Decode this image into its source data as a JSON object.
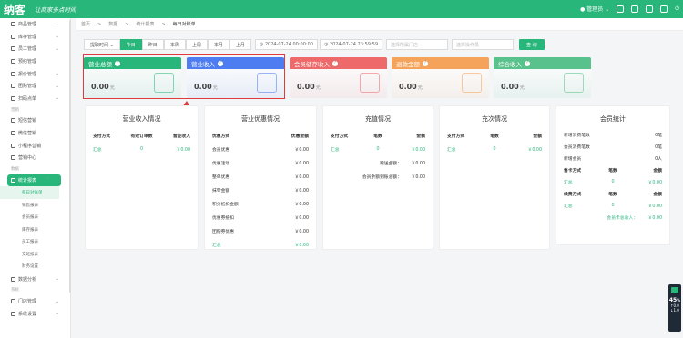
{
  "topbar": {
    "logo": "纳客",
    "slogan": "让商家多点时间",
    "user": "管理员",
    "icons": [
      "user-icon",
      "headset-icon",
      "mail-icon",
      "settings-icon",
      "power-icon"
    ]
  },
  "sidebar": {
    "items": [
      {
        "type": "item",
        "label": "商品管理",
        "chev": "⌄"
      },
      {
        "type": "item",
        "label": "库存管理",
        "chev": "⌄"
      },
      {
        "type": "item",
        "label": "员工管理",
        "chev": "⌄"
      },
      {
        "type": "item",
        "label": "预约管理",
        "chev": ""
      },
      {
        "type": "item",
        "label": "报价管理",
        "chev": "⌄"
      },
      {
        "type": "item",
        "label": "团购管理",
        "chev": "⌄"
      },
      {
        "type": "item",
        "label": "扫码点单",
        "chev": "⌄"
      },
      {
        "type": "sec",
        "label": "营销"
      },
      {
        "type": "item",
        "label": "短信营销",
        "chev": ""
      },
      {
        "type": "item",
        "label": "微信营销",
        "chev": ""
      },
      {
        "type": "item",
        "label": "小程序营销",
        "chev": ""
      },
      {
        "type": "item",
        "label": "营销中心",
        "chev": ""
      },
      {
        "type": "sec",
        "label": "数据"
      },
      {
        "type": "item",
        "label": "统计报表",
        "chev": "⌃",
        "active": true
      },
      {
        "type": "sub",
        "label": "每日对账单",
        "active": true
      },
      {
        "type": "sub",
        "label": "销售报表"
      },
      {
        "type": "sub",
        "label": "会员报表"
      },
      {
        "type": "sub",
        "label": "库存报表"
      },
      {
        "type": "sub",
        "label": "员工报表"
      },
      {
        "type": "sub",
        "label": "交班报表"
      },
      {
        "type": "sub",
        "label": "财务设置"
      },
      {
        "type": "item",
        "label": "数据分析",
        "chev": "⌄"
      },
      {
        "type": "sec",
        "label": "系统"
      },
      {
        "type": "item",
        "label": "门店管理",
        "chev": "⌄"
      },
      {
        "type": "item",
        "label": "系统设置",
        "chev": "⌄"
      }
    ]
  },
  "breadcrumb": [
    "首页",
    "数据",
    "统计报表",
    "每日对账单"
  ],
  "filters": {
    "time_type": "提取时间 ⌄",
    "buttons": [
      "今日",
      "昨日",
      "本周",
      "上周",
      "本月",
      "上月"
    ],
    "active": "今日",
    "start": "2024-07-24 00:00:00",
    "end": "2024-07-24 23:59:59",
    "store_ph": "选择所属门店",
    "operator_ph": "选择操作员",
    "query": "查 询"
  },
  "cards": [
    {
      "title": "营业总额",
      "value": "0.00",
      "unit": "元",
      "color": "#29b67b"
    },
    {
      "title": "营业收入",
      "value": "0.00",
      "unit": "元",
      "color": "#4d7df0"
    },
    {
      "title": "会员储存收入",
      "value": "0.00",
      "unit": "元",
      "color": "#ee6a6a"
    },
    {
      "title": "退款金额",
      "value": "0.00",
      "unit": "元",
      "color": "#f5a25a"
    },
    {
      "title": "综合收入",
      "value": "0.00",
      "unit": "元",
      "color": "#59c18c"
    }
  ],
  "panels": {
    "revenue": {
      "title": "营业收入情况",
      "headers": [
        "支付方式",
        "有效订单数",
        "营业收入"
      ],
      "rows": [
        [
          "汇总",
          "0",
          "￥0.00"
        ]
      ]
    },
    "discount": {
      "title": "营业优惠情况",
      "headers": [
        "优惠方式",
        "优惠金额"
      ],
      "rows": [
        [
          "会员优惠",
          "￥0.00"
        ],
        [
          "优惠活动",
          "￥0.00"
        ],
        [
          "整单优惠",
          "￥0.00"
        ],
        [
          "抹零金额",
          "￥0.00"
        ],
        [
          "积分抵扣金额",
          "￥0.00"
        ],
        [
          "优惠券抵扣",
          "￥0.00"
        ],
        [
          "团购券优惠",
          "￥0.00"
        ],
        [
          "汇总",
          "￥0.00"
        ]
      ]
    },
    "recharge": {
      "title": "充值情况",
      "headers": [
        "支付方式",
        "笔数",
        "金额"
      ],
      "rows": [
        [
          "汇总",
          "0",
          "￥0.00"
        ]
      ],
      "extra": [
        [
          "赠送金额：",
          "￥0.00"
        ],
        [
          "会员余额到账总额：",
          "￥0.00"
        ]
      ]
    },
    "charge": {
      "title": "充次情况",
      "headers": [
        "支付方式",
        "笔数",
        "金额"
      ],
      "rows": [
        [
          "汇总",
          "0",
          "￥0.00"
        ]
      ]
    },
    "member": {
      "title": "会员统计",
      "kv": [
        [
          "新增消费笔数",
          "0笔"
        ],
        [
          "会员消费笔数",
          "0笔"
        ],
        [
          "新增会员",
          "0人"
        ]
      ],
      "sell_headers": [
        "售卡方式",
        "笔数",
        "金额"
      ],
      "sell_rows": [
        [
          "汇总",
          "0",
          "￥0.00"
        ]
      ],
      "renew_headers": [
        "续费方式",
        "笔数",
        "金额"
      ],
      "renew_rows": [
        [
          "汇总",
          "0",
          "￥0.00"
        ]
      ],
      "card_income": "会员卡总收入：",
      "card_income_value": "￥0.00"
    }
  },
  "stat_widget": {
    "pct": "45",
    "unit": "%",
    "up": "0.0",
    "down": "1.0"
  }
}
